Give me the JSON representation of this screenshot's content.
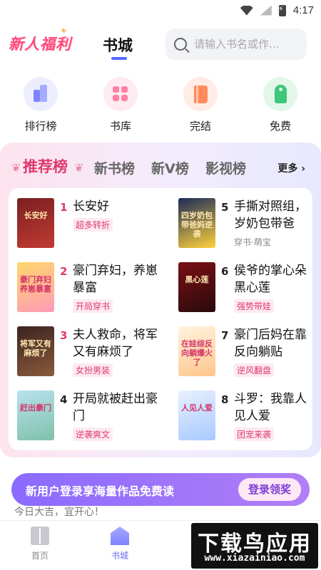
{
  "status_bar": {
    "time": "4:17"
  },
  "header": {
    "promo_label": "新人福利",
    "active_tab": "书城",
    "search_placeholder": "请输入书名或作..."
  },
  "quick_nav": [
    {
      "label": "排行榜",
      "icon": "bar-chart-icon",
      "color": "#7f84ff"
    },
    {
      "label": "书库",
      "icon": "grid-icon",
      "color": "#ff7ea6"
    },
    {
      "label": "完结",
      "icon": "book-icon",
      "color": "#ff8a5c"
    },
    {
      "label": "免费",
      "icon": "tag-icon",
      "color": "#3cc77a"
    }
  ],
  "ranking": {
    "tabs": [
      "推荐榜",
      "新书榜",
      "新V榜",
      "影视榜"
    ],
    "active_tab_index": 0,
    "more_label": "更多 ›",
    "books": [
      {
        "rank": "1",
        "title": "长安好",
        "tag": "超多转折",
        "cover_text": "长安好",
        "cover_colors": [
          "#7a1f22",
          "#c23b32"
        ]
      },
      {
        "rank": "2",
        "title": "豪门弃妇，养崽暴富",
        "tag": "开局穿书",
        "cover_text": "豪门弃妇养崽暴富",
        "cover_colors": [
          "#ffd86b",
          "#ff9ab8"
        ]
      },
      {
        "rank": "3",
        "title": "夫人救命，将军又有麻烦了",
        "tag": "女扮男装",
        "cover_text": "将军又有麻烦了",
        "cover_colors": [
          "#3b2420",
          "#8a5a3c"
        ]
      },
      {
        "rank": "4",
        "title": "开局就被赶出豪门",
        "tag": "逆袭爽文",
        "cover_text": "赶出豪门",
        "cover_colors": [
          "#b9e2f0",
          "#7ec1a8"
        ]
      },
      {
        "rank": "5",
        "title": "手撕对照组，岁奶包带爸",
        "tag": "穿书·萌宝",
        "tag_style": "plain",
        "cover_text": "四岁奶包带爸妈逆袭",
        "cover_colors": [
          "#1c2a5a",
          "#ffd23a"
        ]
      },
      {
        "rank": "6",
        "title": "侯爷的掌心朵黑心莲",
        "tag": "强势带娃",
        "cover_text": "黑心莲",
        "cover_colors": [
          "#7a1016",
          "#2a0a0c"
        ]
      },
      {
        "rank": "7",
        "title": "豪门后妈在靠反向躺贴",
        "tag": "逆风翻盘",
        "cover_text": "在娃综反向躺爆火了",
        "cover_colors": [
          "#fff5e0",
          "#ffc58a"
        ]
      },
      {
        "rank": "8",
        "title": "斗罗：我靠人见人爱",
        "tag": "团宠来袭",
        "cover_text": "人见人爱",
        "cover_colors": [
          "#e8f1ff",
          "#a9c9ff"
        ]
      }
    ]
  },
  "banner": {
    "text": "新用户登录享海量作品免费读",
    "button": "登录领奖"
  },
  "fortune_text": "今日大吉，宜开心！",
  "bottom_nav": [
    {
      "label": "首页",
      "icon": "home-book-icon"
    },
    {
      "label": "书城",
      "icon": "store-icon",
      "active": true
    }
  ],
  "watermark": {
    "main": "下载鸟应用",
    "url": "www.xiazainiao.com"
  }
}
